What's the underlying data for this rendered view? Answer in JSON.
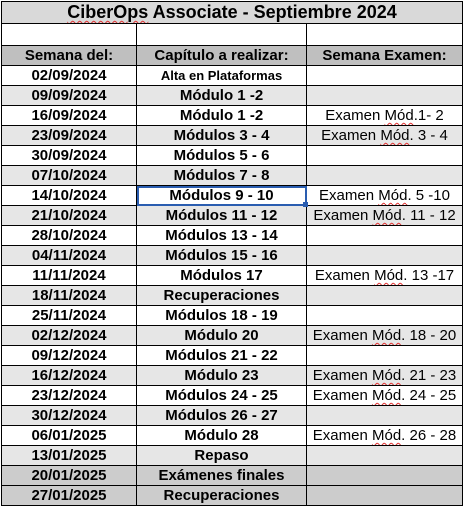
{
  "title": {
    "prefix": "CiberOps",
    "rest": " Associate - Septiembre 2024"
  },
  "headers": [
    "Semana del:",
    "Capítulo a realizar:",
    "Semana Examen:"
  ],
  "rows": [
    {
      "date": "02/09/2024",
      "chapter": "Alta en Plataformas",
      "exam_prefix": "",
      "exam_squiggle": "",
      "exam_suffix": "",
      "style": "white",
      "small": true
    },
    {
      "date": "09/09/2024",
      "chapter": "Módulo 1 -2",
      "exam_prefix": "",
      "exam_squiggle": "",
      "exam_suffix": "",
      "style": "alt"
    },
    {
      "date": "16/09/2024",
      "chapter": "Módulo 1 -2",
      "exam_prefix": "Examen ",
      "exam_squiggle": "Mód",
      "exam_suffix": ".1- 2",
      "style": "white"
    },
    {
      "date": "23/09/2024",
      "chapter": "Módulos 3 - 4",
      "exam_prefix": "Examen ",
      "exam_squiggle": "Mód",
      "exam_suffix": ". 3 - 4",
      "style": "alt"
    },
    {
      "date": "30/09/2024",
      "chapter": "Módulos 5 - 6",
      "exam_prefix": "",
      "exam_squiggle": "",
      "exam_suffix": "",
      "style": "white"
    },
    {
      "date": "07/10/2024",
      "chapter": "Módulos 7 - 8",
      "exam_prefix": "",
      "exam_squiggle": "",
      "exam_suffix": "",
      "style": "alt"
    },
    {
      "date": "14/10/2024",
      "chapter": "Módulos 9 - 10",
      "exam_prefix": "Examen ",
      "exam_squiggle": "Mód",
      "exam_suffix": ". 5 -10",
      "style": "white",
      "selected": true
    },
    {
      "date": "21/10/2024",
      "chapter": "Módulos 11 - 12",
      "exam_prefix": "Examen ",
      "exam_squiggle": "Mód",
      "exam_suffix": ". 11 - 12",
      "style": "alt"
    },
    {
      "date": "28/10/2024",
      "chapter": "Módulos 13 - 14",
      "exam_prefix": "",
      "exam_squiggle": "",
      "exam_suffix": "",
      "style": "white"
    },
    {
      "date": "04/11/2024",
      "chapter": "Módulos 15 - 16",
      "exam_prefix": "",
      "exam_squiggle": "",
      "exam_suffix": "",
      "style": "alt"
    },
    {
      "date": "11/11/2024",
      "chapter": "Módulos 17",
      "exam_prefix": "Examen ",
      "exam_squiggle": "Mód",
      "exam_suffix": ". 13 -17",
      "style": "white"
    },
    {
      "date": "18/11/2024",
      "chapter": "Recuperaciones",
      "exam_prefix": "",
      "exam_squiggle": "",
      "exam_suffix": "",
      "style": "alt"
    },
    {
      "date": "25/11/2024",
      "chapter": "Módulos 18 - 19",
      "exam_prefix": "",
      "exam_squiggle": "",
      "exam_suffix": "",
      "style": "white"
    },
    {
      "date": "02/12/2024",
      "chapter": "Módulo 20",
      "exam_prefix": "Examen ",
      "exam_squiggle": "Mód",
      "exam_suffix": ". 18 - 20",
      "style": "alt"
    },
    {
      "date": "09/12/2024",
      "chapter": "Módulos 21 - 22",
      "exam_prefix": "",
      "exam_squiggle": "",
      "exam_suffix": "",
      "style": "white"
    },
    {
      "date": "16/12/2024",
      "chapter": "Módulo 23",
      "exam_prefix": "Examen ",
      "exam_squiggle": "Mód",
      "exam_suffix": ". 21 - 23",
      "style": "alt"
    },
    {
      "date": "23/12/2024",
      "chapter": "Módulos 24 - 25",
      "exam_prefix": "Examen ",
      "exam_squiggle": "Mód",
      "exam_suffix": ". 24 - 25",
      "style": "white"
    },
    {
      "date": "30/12/2024",
      "chapter": "Módulos 26 - 27",
      "exam_prefix": "",
      "exam_squiggle": "",
      "exam_suffix": "",
      "style": "alt"
    },
    {
      "date": "06/01/2025",
      "chapter": "Módulo 28",
      "exam_prefix": "Examen ",
      "exam_squiggle": "Mód",
      "exam_suffix": ". 26 - 28",
      "style": "white"
    },
    {
      "date": "13/01/2025",
      "chapter": "Repaso",
      "exam_prefix": "",
      "exam_squiggle": "",
      "exam_suffix": "",
      "style": "alt"
    },
    {
      "date": "20/01/2025",
      "chapter": "Exámenes finales",
      "exam_prefix": "",
      "exam_squiggle": "",
      "exam_suffix": "",
      "style": "dark"
    },
    {
      "date": "27/01/2025",
      "chapter": "Recuperaciones",
      "exam_prefix": "",
      "exam_squiggle": "",
      "exam_suffix": "",
      "style": "dark"
    }
  ],
  "colors": {
    "title_bg": "#d9d9d9",
    "header_bg": "#bfbfbf",
    "alt_row_bg": "#e6e6e6",
    "final_rows_bg": "#cccccc",
    "selection": "#2a5db0",
    "spellcheck": "#e03030"
  }
}
